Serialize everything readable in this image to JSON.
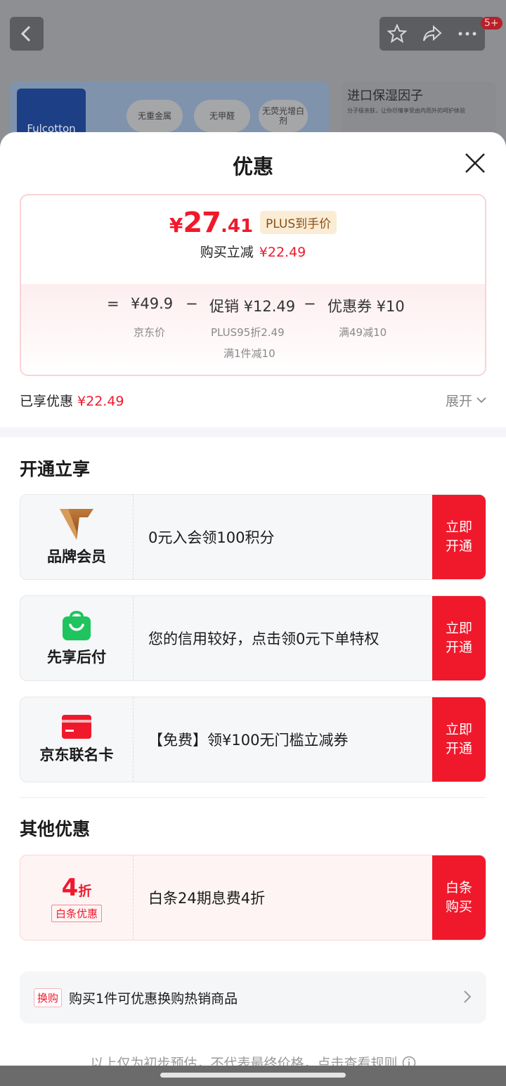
{
  "background": {
    "badge": "5+",
    "brand_logo_text": "Fulcotton",
    "bubbles": [
      "无重金属",
      "无甲醛",
      "无荧光增白剂"
    ],
    "side_title": "进口保湿因子",
    "side_subtitle": "分子级亲肤，让你尽情享受由内而外的呵护体验"
  },
  "sheet": {
    "title": "优惠"
  },
  "price_card": {
    "currency": "¥",
    "price_int": "27",
    "price_dec": ".41",
    "plus_tag": "PLUS到手价",
    "save_label": "购买立减",
    "save_amount": "¥22.49",
    "formula": {
      "eq": "=",
      "jd_price": "¥49.9",
      "minus1": "−",
      "promo": "促销 ¥12.49",
      "minus2": "−",
      "coupon": "优惠券 ¥10"
    },
    "labels": {
      "jd_price_label": "京东价",
      "promo_label_1": "PLUS95折2.49",
      "promo_label_2": "满1件减10",
      "coupon_label": "满49减10"
    }
  },
  "enjoyed": {
    "label": "已享优惠",
    "amount": "¥22.49",
    "expand": "展开"
  },
  "sections": {
    "open_title": "开通立享",
    "other_title": "其他优惠"
  },
  "offers": [
    {
      "left_label": "品牌会员",
      "text": "0元入会领100积分",
      "btn": "立即\n开通"
    },
    {
      "left_label": "先享后付",
      "text": "您的信用较好，点击领0元下单特权",
      "btn": "立即\n开通"
    },
    {
      "left_label": "京东联名卡",
      "text": "【免费】领¥100无门槛立减券",
      "btn": "立即\n开通"
    }
  ],
  "baitiao": {
    "num": "4",
    "unit": "折",
    "tag": "白条优惠",
    "text": "白条24期息费4折",
    "btn": "白条\n购买"
  },
  "swap": {
    "tag": "换购",
    "text": "购买1件可优惠换购热销商品"
  },
  "footnote": "以上仅为初步预估，不代表最终价格，点击查看规则",
  "colors": {
    "accent": "#f0192c",
    "plus_tag_bg": "#fbecd6",
    "green": "#1fc45e"
  }
}
